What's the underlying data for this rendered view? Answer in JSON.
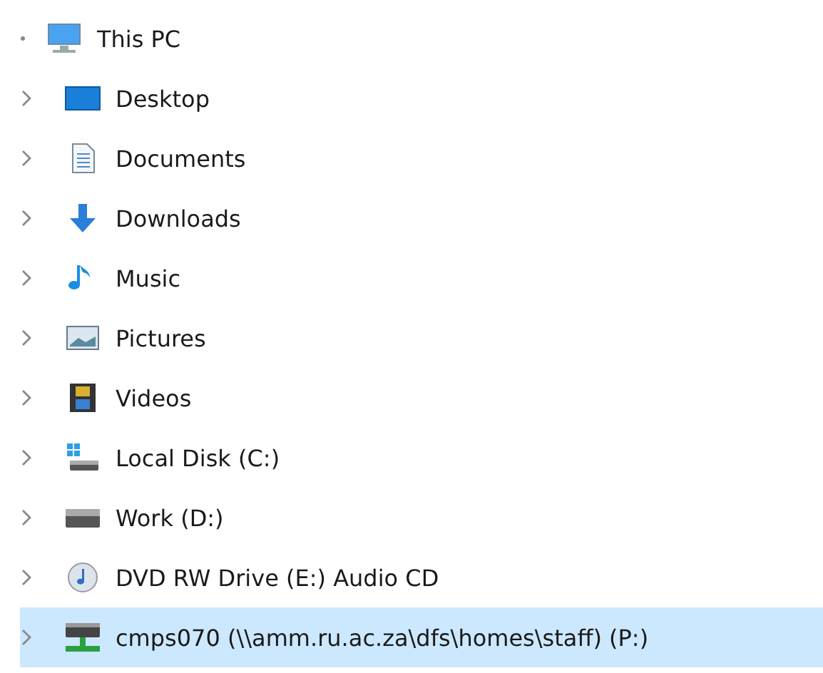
{
  "tree": {
    "label": "This PC",
    "kind": "pc",
    "expanded": true,
    "selected": false,
    "children": [
      {
        "label": "Desktop",
        "kind": "desktop",
        "expanded": false,
        "selected": false
      },
      {
        "label": "Documents",
        "kind": "documents",
        "expanded": false,
        "selected": false
      },
      {
        "label": "Downloads",
        "kind": "downloads",
        "expanded": false,
        "selected": false
      },
      {
        "label": "Music",
        "kind": "music",
        "expanded": false,
        "selected": false
      },
      {
        "label": "Pictures",
        "kind": "pictures",
        "expanded": false,
        "selected": false
      },
      {
        "label": "Videos",
        "kind": "videos",
        "expanded": false,
        "selected": false
      },
      {
        "label": "Local Disk (C:)",
        "kind": "system-drive",
        "expanded": false,
        "selected": false
      },
      {
        "label": "Work (D:)",
        "kind": "drive",
        "expanded": false,
        "selected": false
      },
      {
        "label": "DVD RW Drive (E:) Audio CD",
        "kind": "cd",
        "expanded": false,
        "selected": false
      },
      {
        "label": "cmps070 (\\\\amm.ru.ac.za\\dfs\\homes\\staff) (P:)",
        "kind": "network-drive",
        "expanded": false,
        "selected": true
      }
    ]
  }
}
